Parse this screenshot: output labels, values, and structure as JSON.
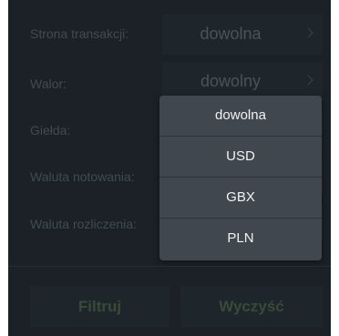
{
  "form": {
    "rows": [
      {
        "label": "Strona transakcji:",
        "value": "dowolna"
      },
      {
        "label": "Walor:",
        "value": "dowolny"
      },
      {
        "label": "Giełda:"
      },
      {
        "label": "Waluta notowania:"
      },
      {
        "label": "Waluta rozliczenia:"
      }
    ]
  },
  "dropdown": {
    "options": [
      "dowolna",
      "USD",
      "GBX",
      "PLN"
    ]
  },
  "buttons": {
    "filter_label": "Filtruj",
    "clear_label": "Wyczyść"
  }
}
